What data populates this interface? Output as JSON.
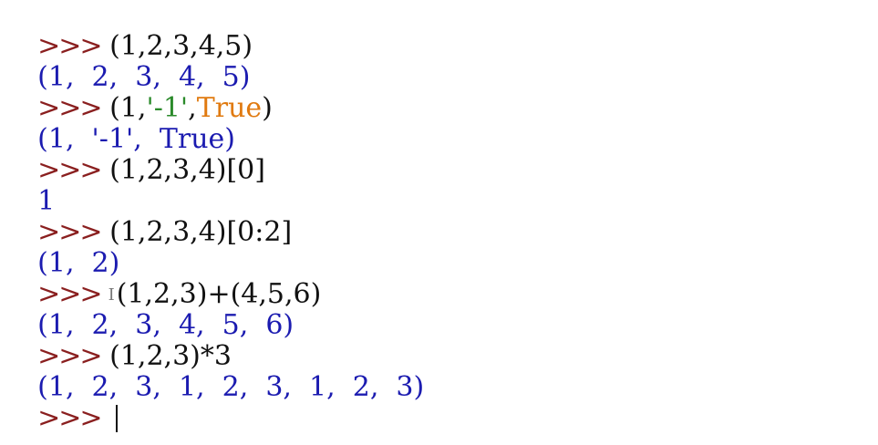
{
  "prompt": ">>>",
  "history": [
    {
      "code": " (1,2,3,4,5)",
      "output": "(1,  2,  3,  4,  5)"
    },
    {
      "code_parts": [
        " (1,",
        "'-1'",
        ",",
        "True",
        ")"
      ],
      "output": "(1,  '-1',  True)"
    },
    {
      "code": " (1,2,3,4)[0]",
      "output": "1"
    },
    {
      "code": " (1,2,3,4)[0:2]",
      "output": "(1,  2)"
    },
    {
      "code": "(1,2,3)+(4,5,6)",
      "output": "(1,  2,  3,  4,  5,  6)"
    },
    {
      "code": " (1,2,3)*3",
      "output": "(1,  2,  3,  1,  2,  3,  1,  2,  3)"
    }
  ],
  "colors": {
    "prompt": "#8a1f1f",
    "code": "#111111",
    "output": "#1b1bb0",
    "string": "#2a8a2a",
    "keyword": "#e07a10"
  }
}
